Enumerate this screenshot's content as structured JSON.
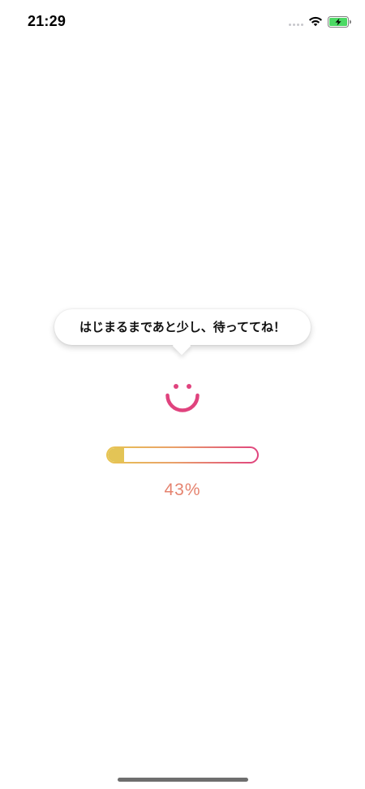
{
  "status_bar": {
    "time": "21:29"
  },
  "bubble": {
    "message": "はじまるまであと少し、待っててね！"
  },
  "progress": {
    "value_percent": 43,
    "label": "43%"
  },
  "colors": {
    "accent_pink": "#e0437e",
    "accent_gold": "#e8c552",
    "percent_text": "#e5836f"
  },
  "icons": [
    "wifi-icon",
    "battery-icon",
    "smiley-icon"
  ]
}
